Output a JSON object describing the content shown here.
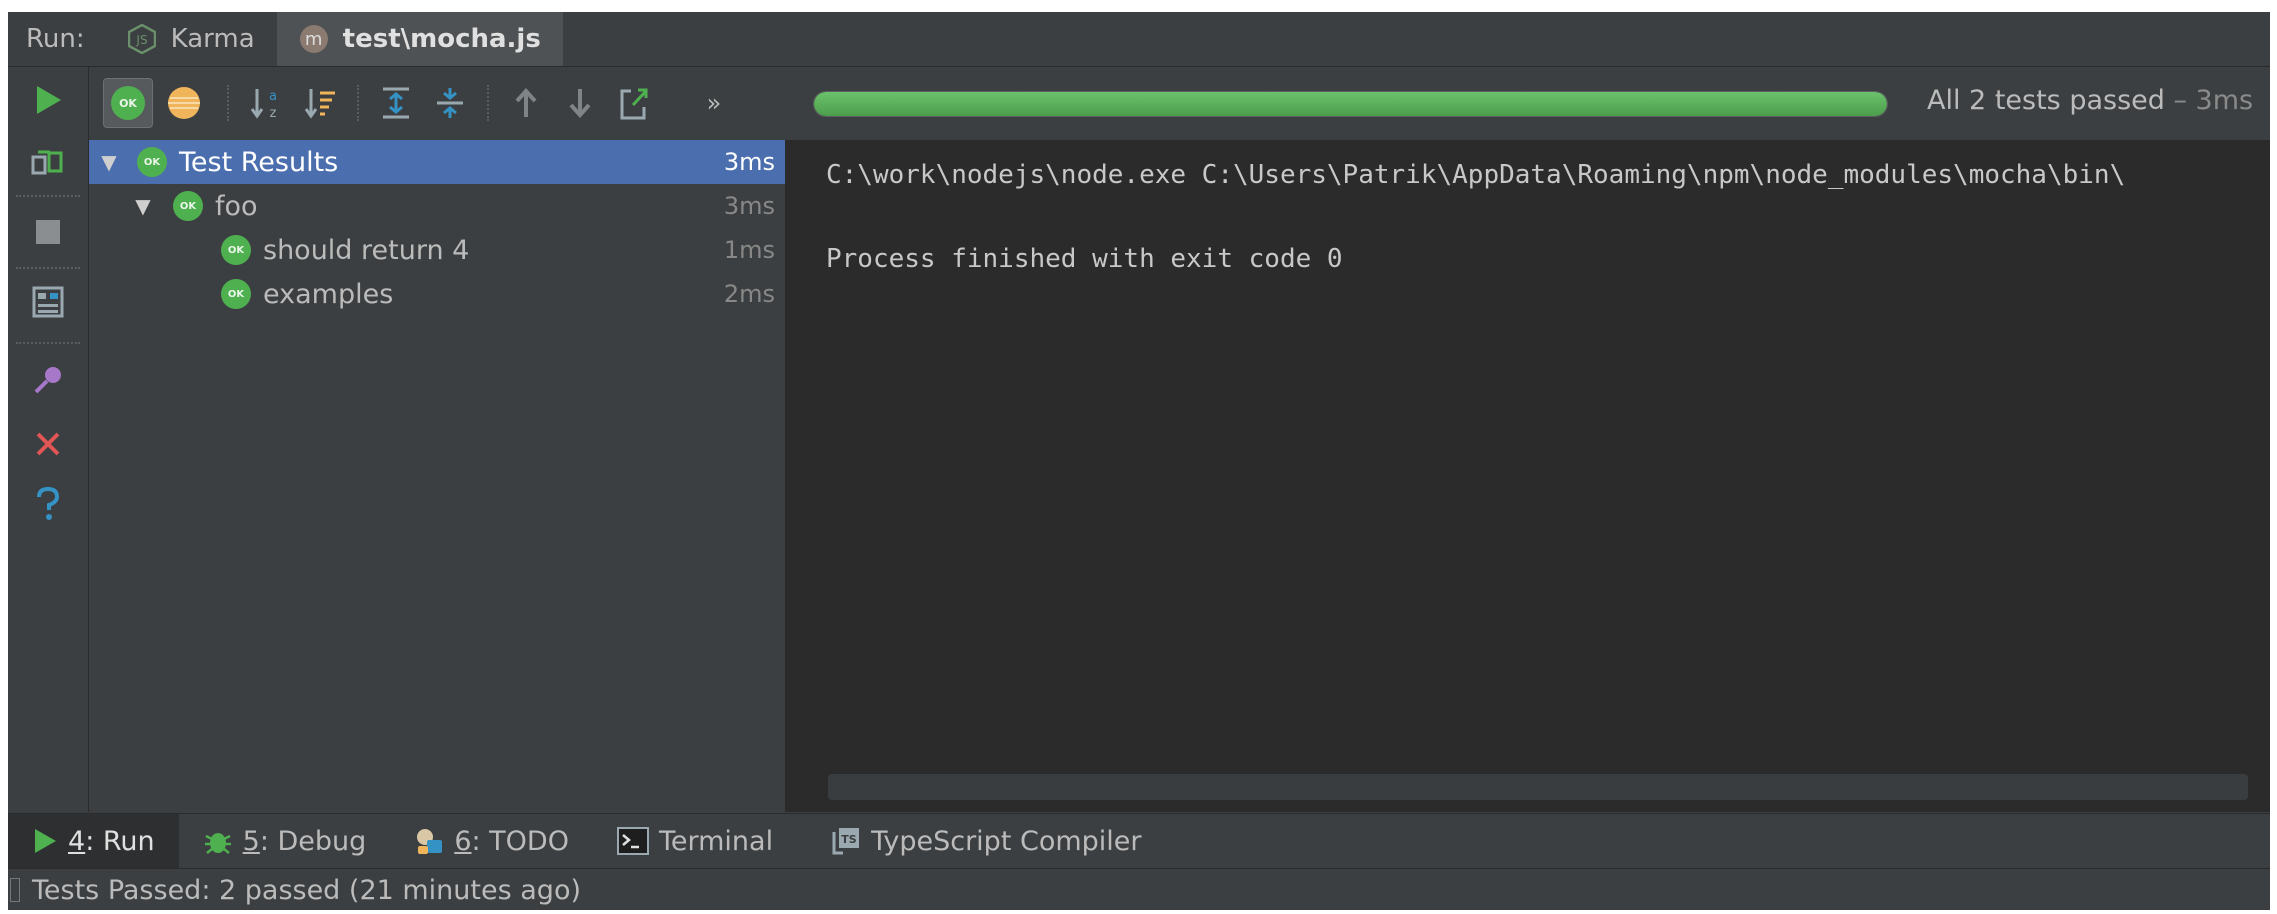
{
  "run_bar": {
    "label": "Run:",
    "tabs": [
      {
        "label": "Karma",
        "icon": "nodejs-icon",
        "active": false
      },
      {
        "label": "test\\mocha.js",
        "icon": "mocha-icon",
        "badge": "m",
        "active": true
      }
    ]
  },
  "toolbar": {
    "more_label": "»",
    "progress_percent": 100,
    "progress_color": "#4fb050",
    "status_text": "All 2 tests passed",
    "status_time": " – 3ms"
  },
  "badges": {
    "ok": "OK"
  },
  "tree": {
    "root": {
      "label": "Test Results",
      "duration": "3ms",
      "selected": true
    },
    "suite": {
      "label": "foo",
      "duration": "3ms"
    },
    "tests": [
      {
        "label": "should return 4",
        "duration": "1ms"
      },
      {
        "label": "examples",
        "duration": "2ms"
      }
    ]
  },
  "console": {
    "command": "C:\\work\\nodejs\\node.exe C:\\Users\\Patrik\\AppData\\Roaming\\npm\\node_modules\\mocha\\bin\\",
    "exit_message": "Process finished with exit code 0"
  },
  "bottom_tabs": [
    {
      "number": "4",
      "rest": ": Run",
      "icon": "run-icon",
      "active": true
    },
    {
      "number": "5",
      "rest": ": Debug",
      "icon": "bug-icon",
      "active": false
    },
    {
      "number": "6",
      "rest": ": TODO",
      "icon": "todo-icon",
      "active": false
    },
    {
      "label": "Terminal",
      "icon": "terminal-icon",
      "active": false
    },
    {
      "label": "TypeScript Compiler",
      "icon": "typescript-icon",
      "active": false
    }
  ],
  "status_bar": {
    "message": "Tests Passed: 2 passed (21 minutes ago)"
  },
  "colors": {
    "background": "#3c3f41",
    "console_background": "#2b2b2b",
    "selection": "#4b6eaf",
    "pass_green": "#4fb050",
    "stop_red": "#e05555",
    "help_blue": "#3592c4"
  }
}
